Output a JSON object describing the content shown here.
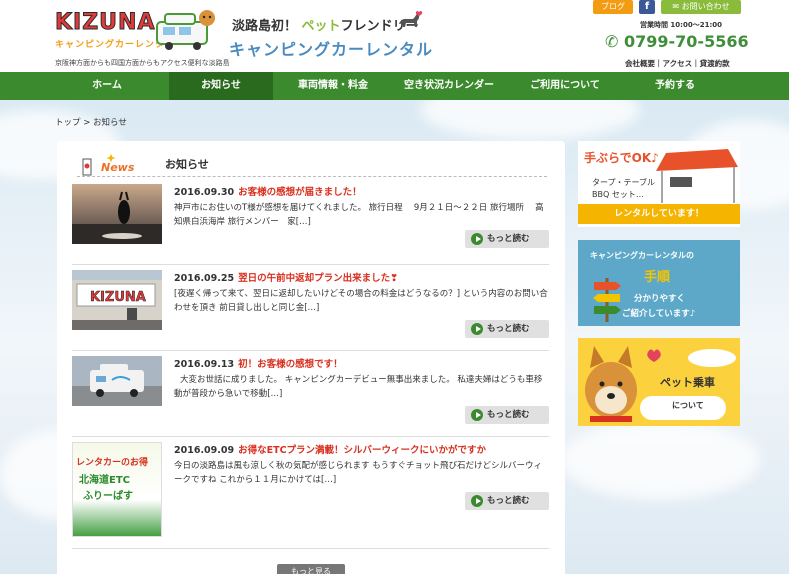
{
  "header": {
    "logo_text": "KIZUNA",
    "logo_sub": "キャンピングカーレンタル",
    "tagline": "京阪神方面からも四国方面からもアクセス便利な淡路島",
    "title1_prefix": "淡路島初！",
    "title1_pet": "ペット",
    "title1_suffix": "フレンドリー",
    "title2": "キャンピングカーレンタル",
    "blog": "ブログ",
    "fb": "f",
    "contact": "お問い合わせ",
    "hours": "営業時間 10:00～21:00",
    "phone": "0799-70-5566",
    "sublinks": "会社概要｜アクセス｜貸渡約款"
  },
  "nav": {
    "items": [
      "ホーム",
      "お知らせ",
      "車両情報・料金",
      "空き状況カレンダー",
      "ご利用について",
      "予約する"
    ],
    "active": "お知らせ"
  },
  "breadcrumb": "トップ > お知らせ",
  "news": {
    "badge": "News",
    "title": "お知らせ",
    "posts": [
      {
        "date": "2016.09.30",
        "title": "お客様の感想が届きました！",
        "body": "神戸市にお住いのT様が感想を届けてくれました。 旅行日程　 9月２１日～２２日 旅行場所　 高知県白浜海岸 旅行メンバー　家[…]",
        "more": "もっと読む"
      },
      {
        "date": "2016.09.25",
        "title": "翌日の午前中返却プラン出来ました❣",
        "body": "[夜遅く帰って来て、翌日に返却したいけどその場合の料金はどうなるの？] という内容のお問い合わせを頂き 前日貸し出しと同じ金[…]",
        "more": "もっと読む"
      },
      {
        "date": "2016.09.13",
        "title": "初！お客様の感想です！",
        "body": "大変お世話に成りました。 キャンピングカーデビュー無事出来ました。 私達夫婦はどうも車移動が普段から急いで移動[…]",
        "more": "もっと読む"
      },
      {
        "date": "2016.09.09",
        "title": "お得なETCプラン満載！シルバーウィークにいかがですか",
        "body": "今日の淡路島は風も涼しく秋の気配が感じられます もうすぐチョット飛び石だけどシルバーウィークですね これから１１月にかけては[…]",
        "more": "もっと読む",
        "thumb_text": [
          "レンタカーのお得",
          "北海道ETC",
          "ふりーぱす"
        ]
      }
    ],
    "more_all": "もっと見る"
  },
  "sidebar": {
    "bbq": {
      "line1": "手ぶらでOK♪",
      "line2": "タープ・テーブル",
      "line3": "BBQ セット…",
      "band": "レンタルしています！"
    },
    "steps": {
      "line1": "キャンピングカーレンタルの",
      "line2": "手順",
      "line3": "分かりやすく",
      "line4": "ご紹介しています♪"
    },
    "pet": {
      "line1": "ペット乗車",
      "line2": "について"
    }
  },
  "colors": {
    "nav_green": "#3c8a2e",
    "nav_active": "#2a6a1e",
    "title_red": "#d9301f",
    "title_blue": "#4a8bbf",
    "orange": "#f39c12"
  }
}
